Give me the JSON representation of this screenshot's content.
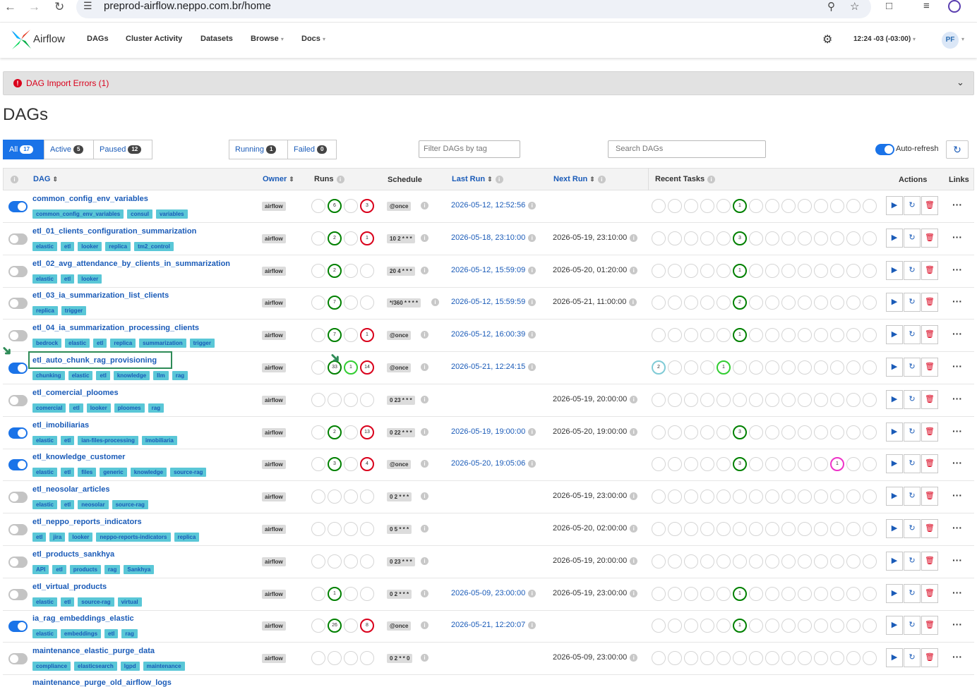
{
  "browser": {
    "url": "preprod-airflow.neppo.com.br/home"
  },
  "nav": {
    "brand": "Airflow",
    "items": [
      {
        "label": "DAGs",
        "caret": false
      },
      {
        "label": "Cluster Activity",
        "caret": false
      },
      {
        "label": "Datasets",
        "caret": false
      },
      {
        "label": "Browse",
        "caret": true
      },
      {
        "label": "Docs",
        "caret": true
      }
    ],
    "time": "12:24 -03 (-03:00)",
    "user_initials": "PF"
  },
  "alert": {
    "text": "DAG Import Errors (1)"
  },
  "page_title": "DAGs",
  "filters": {
    "all": {
      "label": "All",
      "count": "17"
    },
    "active": {
      "label": "Active",
      "count": "5"
    },
    "paused": {
      "label": "Paused",
      "count": "12"
    },
    "running": {
      "label": "Running",
      "count": "1"
    },
    "failed": {
      "label": "Failed",
      "count": "0"
    },
    "tag_placeholder": "Filter DAGs by tag",
    "search_placeholder": "Search DAGs",
    "auto_refresh": "Auto-refresh"
  },
  "columns": {
    "dag": "DAG",
    "owner": "Owner",
    "runs": "Runs",
    "schedule": "Schedule",
    "last_run": "Last Run",
    "next_run": "Next Run",
    "recent_tasks": "Recent Tasks",
    "actions": "Actions",
    "links": "Links"
  },
  "colors": {
    "accent": "#1a73e8",
    "link": "#1a5bb8",
    "success": "#008000",
    "failed": "#d9001b",
    "running": "#32cd32",
    "tag": "#5ac7d7"
  },
  "dags": [
    {
      "name": "common_config_env_variables",
      "active": true,
      "tags": [
        "common_config_env_variables",
        "consul",
        "variables"
      ],
      "owner": "airflow",
      "runs": [
        {
          "s": "",
          "n": ""
        },
        {
          "s": "success",
          "n": "6"
        },
        {
          "s": "",
          "n": ""
        },
        {
          "s": "failed",
          "n": "3"
        }
      ],
      "schedule": "@once",
      "last_run": "2026-05-12, 12:52:56",
      "next_run": "",
      "tasks": {
        "5": [
          "success",
          "1"
        ]
      }
    },
    {
      "name": "etl_01_clients_configuration_summarization",
      "active": false,
      "tags": [
        "elastic",
        "etl",
        "looker",
        "replica",
        "tm2_control"
      ],
      "owner": "airflow",
      "runs": [
        {
          "s": "",
          "n": ""
        },
        {
          "s": "success",
          "n": "2"
        },
        {
          "s": "",
          "n": ""
        },
        {
          "s": "failed",
          "n": "1"
        }
      ],
      "schedule": "10 2 * * *",
      "last_run": "2026-05-18, 23:10:00",
      "next_run": "2026-05-19, 23:10:00",
      "tasks": {
        "5": [
          "success",
          "3"
        ]
      }
    },
    {
      "name": "etl_02_avg_attendance_by_clients_in_summarization",
      "active": false,
      "tags": [
        "elastic",
        "etl",
        "looker"
      ],
      "owner": "airflow",
      "runs": [
        {
          "s": "",
          "n": ""
        },
        {
          "s": "success",
          "n": "2"
        },
        {
          "s": "",
          "n": ""
        },
        {
          "s": "",
          "n": ""
        }
      ],
      "schedule": "20 4 * * *",
      "last_run": "2026-05-12, 15:59:09",
      "next_run": "2026-05-20, 01:20:00",
      "tasks": {
        "5": [
          "success",
          "1"
        ]
      }
    },
    {
      "name": "etl_03_ia_summarization_list_clients",
      "active": false,
      "tags": [
        "replica",
        "trigger"
      ],
      "owner": "airflow",
      "runs": [
        {
          "s": "",
          "n": ""
        },
        {
          "s": "success",
          "n": "7"
        },
        {
          "s": "",
          "n": ""
        },
        {
          "s": "",
          "n": ""
        }
      ],
      "schedule": "*/360 * * * *",
      "last_run": "2026-05-12, 15:59:59",
      "next_run": "2026-05-21, 11:00:00",
      "tasks": {
        "5": [
          "success",
          "2"
        ]
      }
    },
    {
      "name": "etl_04_ia_summarization_processing_clients",
      "active": false,
      "tags": [
        "bedrock",
        "elastic",
        "etl",
        "replica",
        "summarization",
        "trigger"
      ],
      "owner": "airflow",
      "runs": [
        {
          "s": "",
          "n": ""
        },
        {
          "s": "success",
          "n": "7"
        },
        {
          "s": "",
          "n": ""
        },
        {
          "s": "failed",
          "n": "1"
        }
      ],
      "schedule": "@once",
      "last_run": "2026-05-12, 16:00:39",
      "next_run": "",
      "tasks": {
        "5": [
          "success",
          "1"
        ]
      }
    },
    {
      "name": "etl_auto_chunk_rag_provisioning",
      "active": true,
      "tags": [
        "chunking",
        "elastic",
        "etl",
        "knowledge",
        "llm",
        "rag"
      ],
      "owner": "airflow",
      "runs": [
        {
          "s": "",
          "n": ""
        },
        {
          "s": "success",
          "n": "33"
        },
        {
          "s": "running",
          "n": "1"
        },
        {
          "s": "failed",
          "n": "14"
        }
      ],
      "schedule": "@once",
      "last_run": "2026-05-21, 12:24:15",
      "next_run": "",
      "tasks": {
        "0": [
          "queued",
          "2"
        ],
        "4": [
          "running",
          "1"
        ]
      }
    },
    {
      "name": "etl_comercial_ploomes",
      "active": false,
      "tags": [
        "comercial",
        "etl",
        "looker",
        "ploomes",
        "rag"
      ],
      "owner": "airflow",
      "runs": [
        {
          "s": "",
          "n": ""
        },
        {
          "s": "",
          "n": ""
        },
        {
          "s": "",
          "n": ""
        },
        {
          "s": "",
          "n": ""
        }
      ],
      "schedule": "0 23 * * *",
      "last_run": "",
      "next_run": "2026-05-19, 20:00:00",
      "tasks": {}
    },
    {
      "name": "etl_imobiliarias",
      "active": true,
      "tags": [
        "elastic",
        "etl",
        "ian-files-processing",
        "imobiliaria"
      ],
      "owner": "airflow",
      "runs": [
        {
          "s": "",
          "n": ""
        },
        {
          "s": "success",
          "n": "2"
        },
        {
          "s": "",
          "n": ""
        },
        {
          "s": "failed",
          "n": "13"
        }
      ],
      "schedule": "0 22 * * *",
      "last_run": "2026-05-19, 19:00:00",
      "next_run": "2026-05-20, 19:00:00",
      "tasks": {
        "5": [
          "success",
          "3"
        ]
      }
    },
    {
      "name": "etl_knowledge_customer",
      "active": true,
      "tags": [
        "elastic",
        "etl",
        "files",
        "generic",
        "knowledge",
        "source-rag"
      ],
      "owner": "airflow",
      "runs": [
        {
          "s": "",
          "n": ""
        },
        {
          "s": "success",
          "n": "3"
        },
        {
          "s": "",
          "n": ""
        },
        {
          "s": "failed",
          "n": "4"
        }
      ],
      "schedule": "@once",
      "last_run": "2026-05-20, 19:05:06",
      "next_run": "",
      "tasks": {
        "5": [
          "success",
          "3"
        ],
        "11": [
          "upstream",
          "1"
        ]
      }
    },
    {
      "name": "etl_neosolar_articles",
      "active": false,
      "tags": [
        "elastic",
        "etl",
        "neosolar",
        "source-rag"
      ],
      "owner": "airflow",
      "runs": [
        {
          "s": "",
          "n": ""
        },
        {
          "s": "",
          "n": ""
        },
        {
          "s": "",
          "n": ""
        },
        {
          "s": "",
          "n": ""
        }
      ],
      "schedule": "0 2 * * *",
      "last_run": "",
      "next_run": "2026-05-19, 23:00:00",
      "tasks": {}
    },
    {
      "name": "etl_neppo_reports_indicators",
      "active": false,
      "tags": [
        "etl",
        "jira",
        "looker",
        "neppo-reports-indicators",
        "replica"
      ],
      "owner": "airflow",
      "runs": [
        {
          "s": "",
          "n": ""
        },
        {
          "s": "",
          "n": ""
        },
        {
          "s": "",
          "n": ""
        },
        {
          "s": "",
          "n": ""
        }
      ],
      "schedule": "0 5 * * *",
      "last_run": "",
      "next_run": "2026-05-20, 02:00:00",
      "tasks": {}
    },
    {
      "name": "etl_products_sankhya",
      "active": false,
      "tags": [
        "API",
        "etl",
        "products",
        "rag",
        "Sankhya"
      ],
      "owner": "airflow",
      "runs": [
        {
          "s": "",
          "n": ""
        },
        {
          "s": "",
          "n": ""
        },
        {
          "s": "",
          "n": ""
        },
        {
          "s": "",
          "n": ""
        }
      ],
      "schedule": "0 23 * * *",
      "last_run": "",
      "next_run": "2026-05-19, 20:00:00",
      "tasks": {}
    },
    {
      "name": "etl_virtual_products",
      "active": false,
      "tags": [
        "elastic",
        "etl",
        "source-rag",
        "virtual"
      ],
      "owner": "airflow",
      "runs": [
        {
          "s": "",
          "n": ""
        },
        {
          "s": "success",
          "n": "1"
        },
        {
          "s": "",
          "n": ""
        },
        {
          "s": "",
          "n": ""
        }
      ],
      "schedule": "0 2 * * *",
      "last_run": "2026-05-09, 23:00:00",
      "next_run": "2026-05-19, 23:00:00",
      "tasks": {
        "5": [
          "success",
          "1"
        ]
      }
    },
    {
      "name": "ia_rag_embeddings_elastic",
      "active": true,
      "tags": [
        "elastic",
        "embeddings",
        "etl",
        "rag"
      ],
      "owner": "airflow",
      "runs": [
        {
          "s": "",
          "n": ""
        },
        {
          "s": "success",
          "n": "26"
        },
        {
          "s": "",
          "n": ""
        },
        {
          "s": "failed",
          "n": "8"
        }
      ],
      "schedule": "@once",
      "last_run": "2026-05-21, 12:20:07",
      "next_run": "",
      "tasks": {
        "5": [
          "success",
          "1"
        ]
      }
    },
    {
      "name": "maintenance_elastic_purge_data",
      "active": false,
      "tags": [
        "compliance",
        "elasticsearch",
        "lgpd",
        "maintenance"
      ],
      "owner": "airflow",
      "runs": [
        {
          "s": "",
          "n": ""
        },
        {
          "s": "",
          "n": ""
        },
        {
          "s": "",
          "n": ""
        },
        {
          "s": "",
          "n": ""
        }
      ],
      "schedule": "0 2 * * 0",
      "last_run": "",
      "next_run": "2026-05-09, 23:00:00",
      "tasks": {}
    }
  ],
  "partial_row": "maintenance_purge_old_airflow_logs"
}
